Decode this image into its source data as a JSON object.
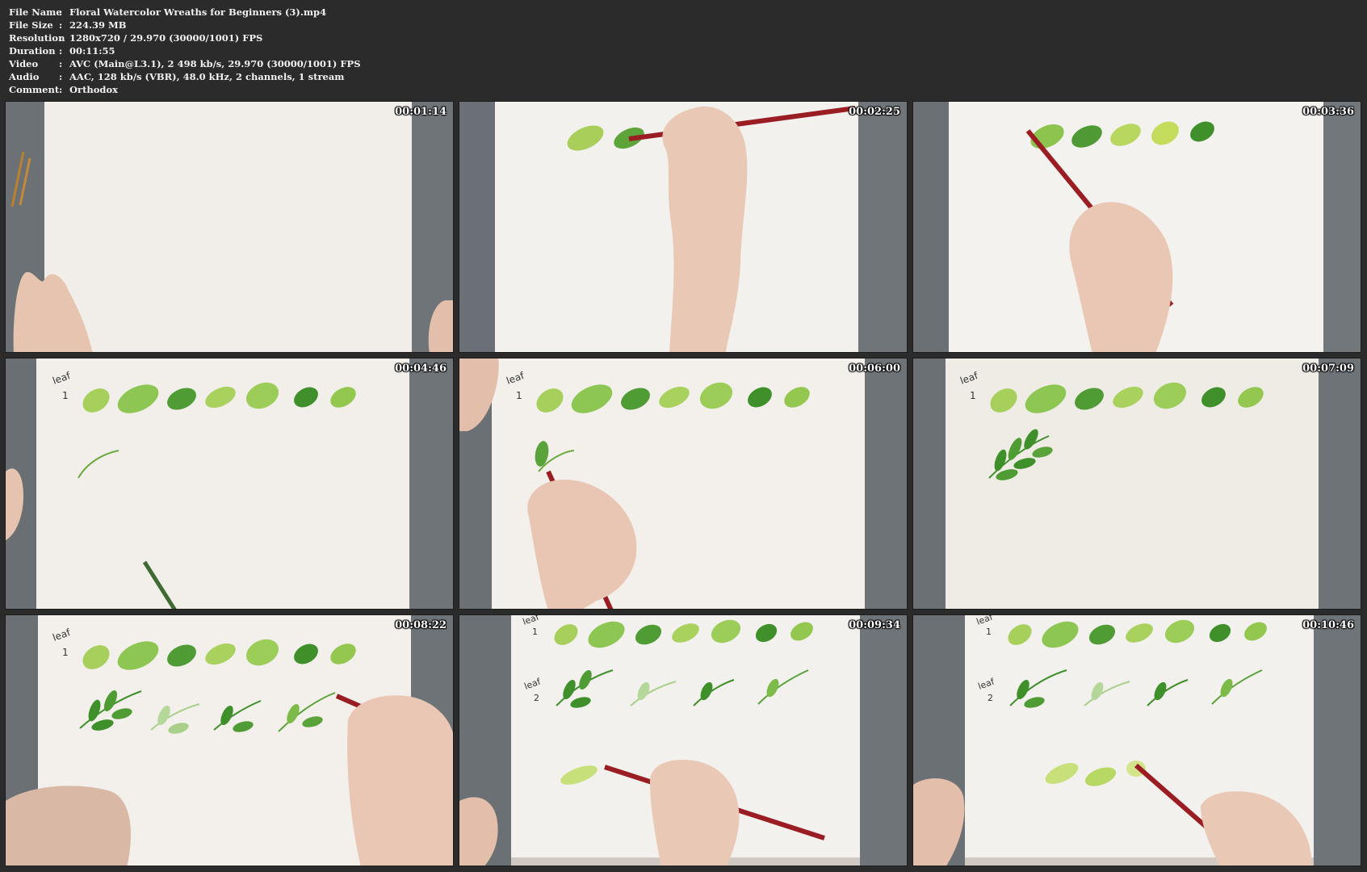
{
  "info": {
    "rows": [
      {
        "key": "File Name",
        "value": "Floral Watercolor Wreaths for Beginners (3).mp4"
      },
      {
        "key": "File Size",
        "value": "224.39 MB"
      },
      {
        "key": "Resolution",
        "value": "1280x720 / 29.970 (30000/1001) FPS"
      },
      {
        "key": "Duration",
        "value": "00:11:55"
      },
      {
        "key": "Video",
        "value": "AVC (Main@L3.1), 2 498 kb/s, 29.970 (30000/1001) FPS"
      },
      {
        "key": "Audio",
        "value": "AAC, 128 kb/s (VBR), 48.0 kHz, 2 channels, 1 stream"
      },
      {
        "key": "Comment",
        "value": "Orthodox"
      }
    ],
    "separator": ":"
  },
  "thumbnails": [
    {
      "timestamp": "00:01:14"
    },
    {
      "timestamp": "00:02:25"
    },
    {
      "timestamp": "00:03:36"
    },
    {
      "timestamp": "00:04:46",
      "labels": [
        "leaf",
        "1"
      ]
    },
    {
      "timestamp": "00:06:00",
      "labels": [
        "leaf",
        "1"
      ]
    },
    {
      "timestamp": "00:07:09",
      "labels": [
        "leaf",
        "1"
      ]
    },
    {
      "timestamp": "00:08:22",
      "labels": [
        "leaf",
        "1"
      ]
    },
    {
      "timestamp": "00:09:34",
      "labels": [
        "leaf",
        "1",
        "leaf",
        "2"
      ]
    },
    {
      "timestamp": "00:10:46",
      "labels": [
        "leaf",
        "1",
        "leaf",
        "2"
      ]
    }
  ],
  "colors": {
    "background": "#2b2b2b",
    "paper": "#f3f1ee",
    "table": "#7b8084",
    "leaf_dark": "#3f8f2a",
    "leaf_light": "#a9cf5a",
    "brush_handle": "#9b1d24",
    "skin": "#e8c7b4"
  }
}
